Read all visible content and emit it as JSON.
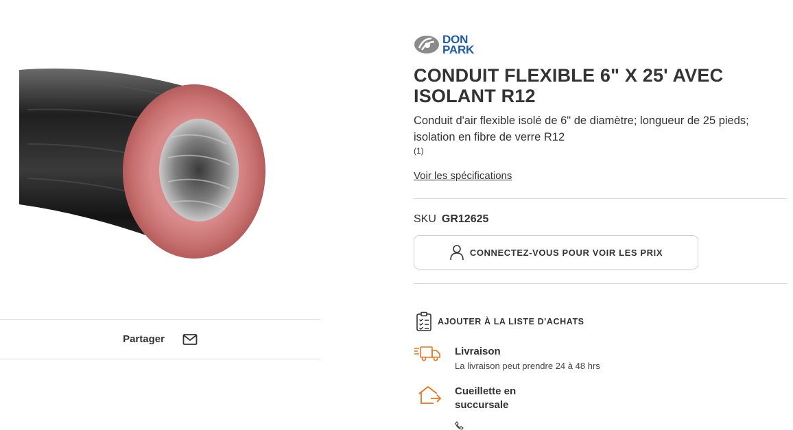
{
  "brand": {
    "line1": "DON",
    "line2": "PARK",
    "color": "#1f5aa6"
  },
  "product": {
    "title": "CONDUIT FLEXIBLE 6\" X 25' AVEC ISOLANT R12",
    "description": "Conduit d'air flexible isolé de 6\" de diamètre; longueur de 25 pieds; isolation en fibre de verre R12",
    "rating_count": "(1)",
    "spec_link": "Voir les spécifications",
    "sku_label": "SKU",
    "sku_value": "GR12625"
  },
  "share": {
    "label": "Partager",
    "icon": "mail-icon"
  },
  "login_button": {
    "label": "CONNECTEZ-VOUS POUR VOIR LES PRIX",
    "icon": "user-icon"
  },
  "shopping_list": {
    "label": "AJOUTER À LA LISTE D'ACHATS",
    "icon": "clipboard-list-icon"
  },
  "fulfillment": {
    "accent_color": "#e8731a",
    "delivery": {
      "title": "Livraison",
      "subtitle": "La livraison peut prendre 24 à 48 hrs",
      "icon": "delivery-truck-icon"
    },
    "pickup": {
      "title": "Cueillette en succursale",
      "icon": "store-pickup-icon"
    },
    "phone_icon": "phone-icon"
  }
}
